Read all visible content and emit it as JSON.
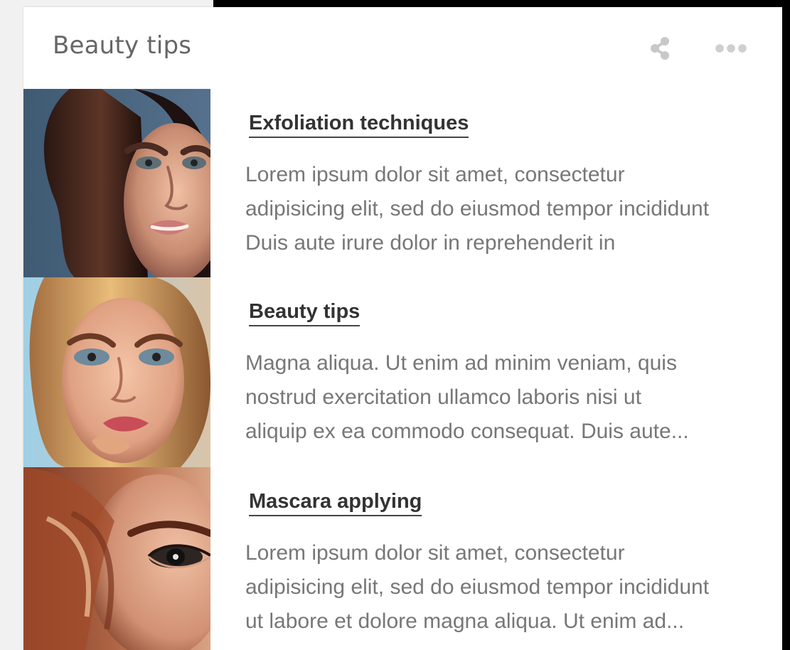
{
  "widget": {
    "title": "Beauty tips",
    "actions": {
      "share_icon": "share-icon",
      "more_icon": "more-horizontal-icon"
    }
  },
  "stories": [
    {
      "title": "Exfoliation techniques",
      "lines": [
        "Lorem ipsum dolor sit amet, consectetur",
        "adipisicing elit, sed do eiusmod tempor incididunt",
        "Duis aute irure dolor in reprehenderit in"
      ]
    },
    {
      "title": "Beauty tips",
      "lines": [
        "Magna aliqua. Ut enim ad minim veniam, quis",
        "nostrud exercitation ullamco laboris nisi ut",
        "aliquip ex ea commodo consequat. Duis aute..."
      ]
    },
    {
      "title": "Mascara applying",
      "lines": [
        "Lorem ipsum dolor sit amet, consectetur",
        "adipisicing elit, sed do eiusmod tempor incididunt",
        "ut labore et dolore magna aliqua. Ut enim ad..."
      ]
    }
  ],
  "colors": {
    "background": "#f1f1f1",
    "card": "#ffffff",
    "title": "#666666",
    "headline": "#333333",
    "body": "#777777",
    "divider": "#eeeeee"
  }
}
